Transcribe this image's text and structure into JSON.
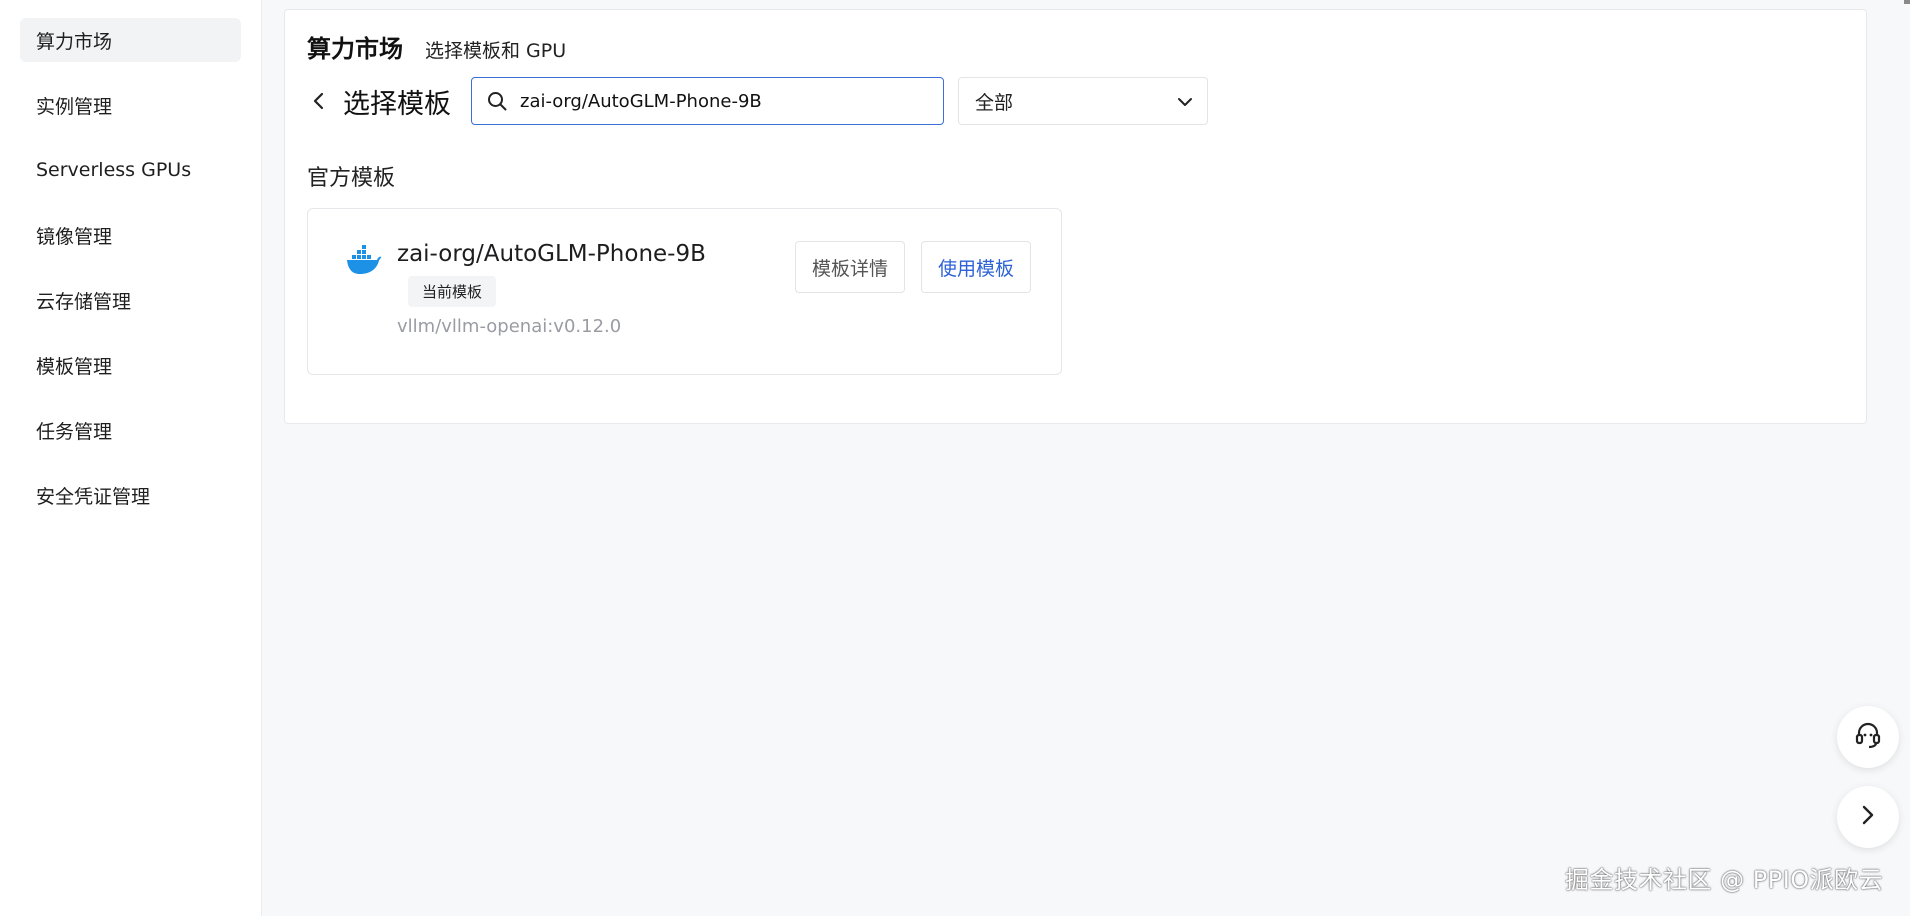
{
  "sidebar": {
    "items": [
      {
        "label": "算力市场",
        "active": true
      },
      {
        "label": "实例管理"
      },
      {
        "label": "Serverless GPUs"
      },
      {
        "label": "镜像管理"
      },
      {
        "label": "云存储管理"
      },
      {
        "label": "模板管理"
      },
      {
        "label": "任务管理"
      },
      {
        "label": "安全凭证管理"
      }
    ]
  },
  "header": {
    "title": "算力市场",
    "subtitle": "选择模板和 GPU"
  },
  "selector": {
    "title": "选择模板",
    "search_value": "zai-org/AutoGLM-Phone-9B",
    "filter_value": "全部"
  },
  "section": {
    "title": "官方模板"
  },
  "template": {
    "name": "zai-org/AutoGLM-Phone-9B",
    "badge": "当前模板",
    "image": "vllm/vllm-openai:v0.12.0",
    "details_label": "模板详情",
    "use_label": "使用模板"
  },
  "watermark": "掘金技术社区 @ PPIO派欧云",
  "colors": {
    "accent": "#2e63d6",
    "docker_blue": "#1d91e6",
    "page_bg": "#f7f8fa"
  }
}
